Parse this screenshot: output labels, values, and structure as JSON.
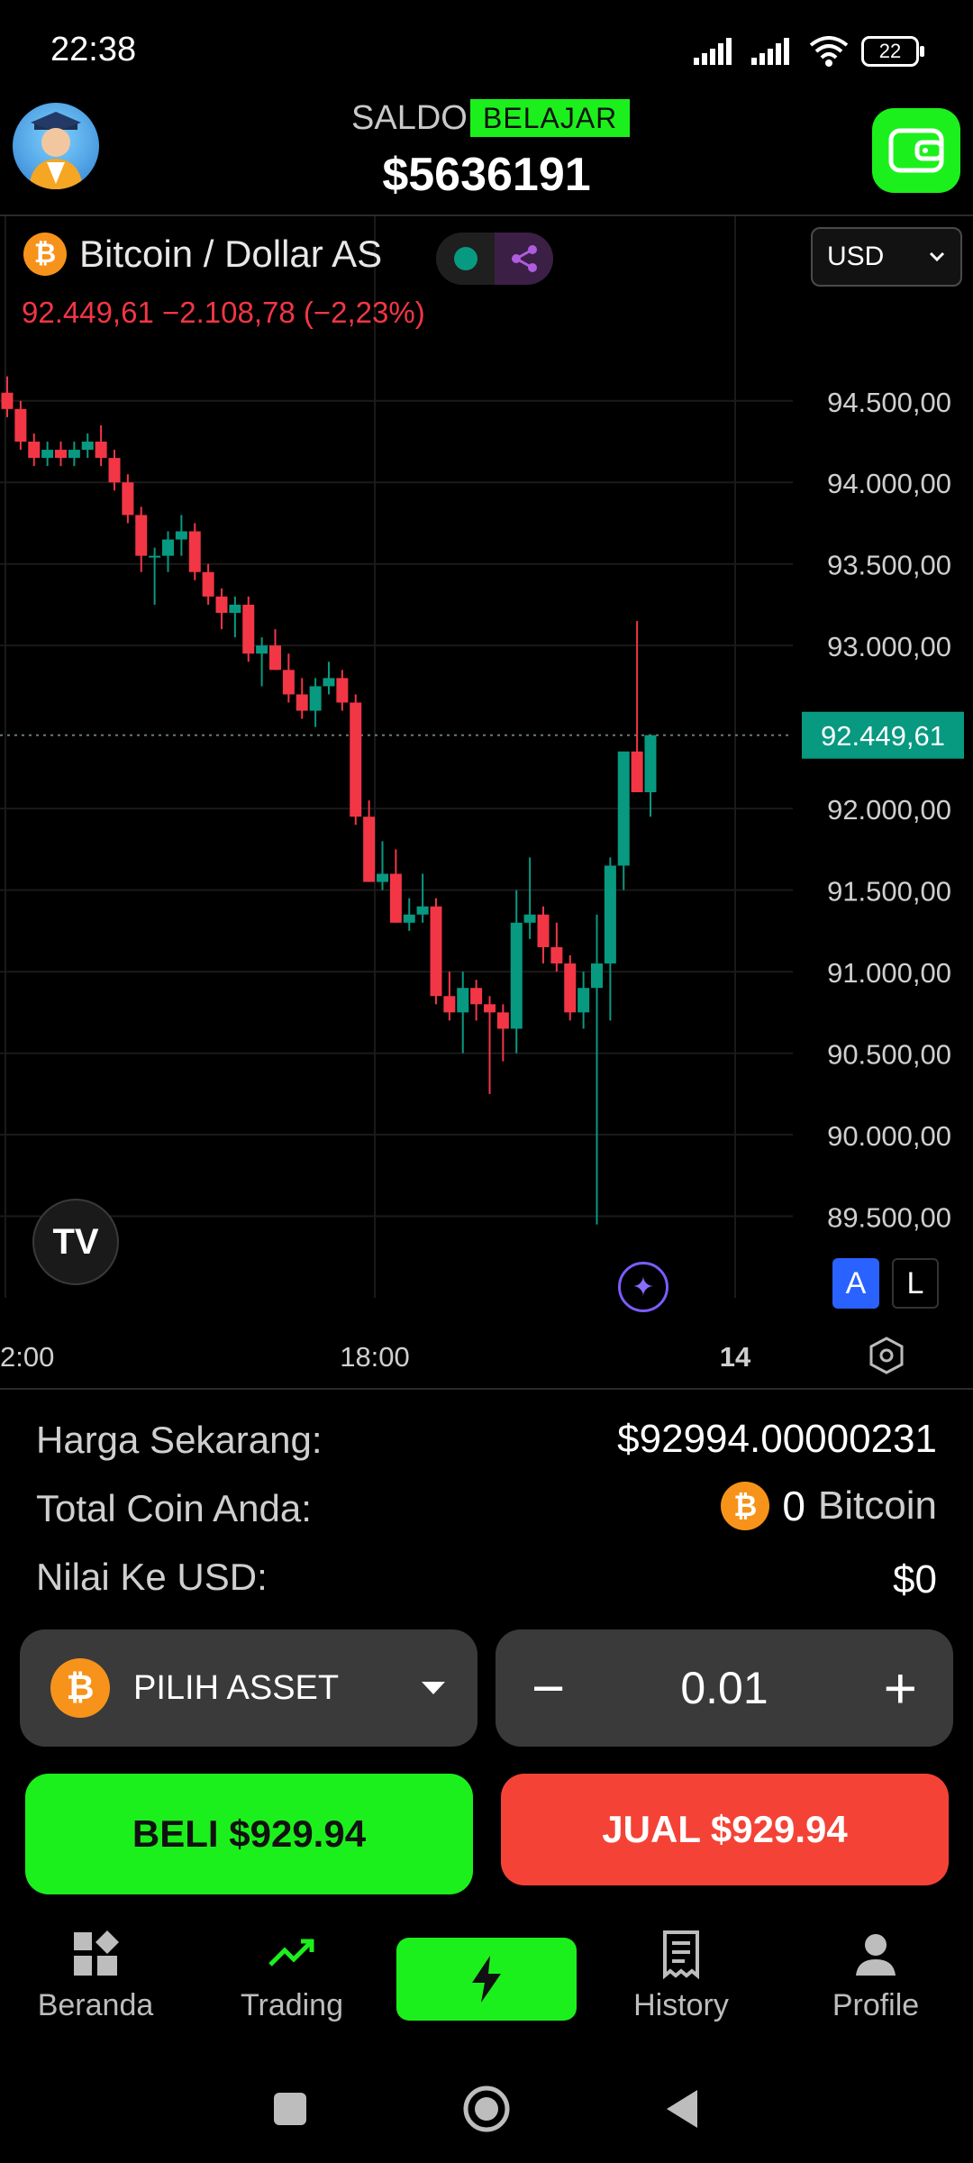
{
  "status_bar": {
    "time": "22:38",
    "battery": "22"
  },
  "header": {
    "saldo_label": "SALDO",
    "mode_badge": "BELAJAR",
    "balance": "$5636191"
  },
  "chart_header": {
    "coin_symbol": "₿",
    "title": "Bitcoin / Dollar AS",
    "price_change": "92.449,61  −2.108,78 (−2,23%)",
    "currency": "USD",
    "tv_logo": "TV",
    "auto_label": "A",
    "log_label": "L"
  },
  "chart_data": {
    "type": "candlestick",
    "y_ticks": [
      "94.500,00",
      "94.000,00",
      "93.500,00",
      "93.000,00",
      "92.000,00",
      "91.500,00",
      "91.000,00",
      "90.500,00",
      "90.000,00",
      "89.500,00"
    ],
    "y_tick_values": [
      94500,
      94000,
      93500,
      93000,
      92000,
      91500,
      91000,
      90500,
      90000,
      89500
    ],
    "ylim": [
      89000,
      95300
    ],
    "x_ticks": [
      "2:00",
      "18:00",
      "14"
    ],
    "current_price_label": "92.449,61",
    "current_price": 92449.61,
    "colors": {
      "up": "#089981",
      "down": "#f23645",
      "grid": "#1a1a1a",
      "price_tag": "#089981"
    },
    "candles": [
      [
        94550,
        94650,
        94400,
        94450
      ],
      [
        94450,
        94500,
        94200,
        94250
      ],
      [
        94250,
        94300,
        94100,
        94150
      ],
      [
        94150,
        94250,
        94100,
        94200
      ],
      [
        94200,
        94250,
        94100,
        94150
      ],
      [
        94150,
        94250,
        94100,
        94200
      ],
      [
        94200,
        94300,
        94150,
        94250
      ],
      [
        94250,
        94350,
        94100,
        94150
      ],
      [
        94150,
        94200,
        93950,
        94000
      ],
      [
        94000,
        94050,
        93750,
        93800
      ],
      [
        93800,
        93850,
        93450,
        93550
      ],
      [
        93550,
        93600,
        93250,
        93550
      ],
      [
        93550,
        93700,
        93450,
        93650
      ],
      [
        93650,
        93800,
        93550,
        93700
      ],
      [
        93700,
        93750,
        93400,
        93450
      ],
      [
        93450,
        93500,
        93250,
        93300
      ],
      [
        93300,
        93350,
        93100,
        93200
      ],
      [
        93200,
        93300,
        93050,
        93250
      ],
      [
        93250,
        93300,
        92900,
        92950
      ],
      [
        92950,
        93050,
        92750,
        93000
      ],
      [
        93000,
        93100,
        92850,
        92850
      ],
      [
        92850,
        92950,
        92650,
        92700
      ],
      [
        92700,
        92800,
        92550,
        92600
      ],
      [
        92600,
        92800,
        92500,
        92750
      ],
      [
        92750,
        92900,
        92700,
        92800
      ],
      [
        92800,
        92850,
        92600,
        92650
      ],
      [
        92650,
        92700,
        91900,
        91950
      ],
      [
        91950,
        92050,
        91550,
        91550
      ],
      [
        91550,
        91800,
        91500,
        91600
      ],
      [
        91600,
        91750,
        91300,
        91300
      ],
      [
        91300,
        91450,
        91250,
        91350
      ],
      [
        91350,
        91600,
        91300,
        91400
      ],
      [
        91400,
        91450,
        90800,
        90850
      ],
      [
        90850,
        91000,
        90700,
        90750
      ],
      [
        90750,
        91000,
        90500,
        90900
      ],
      [
        90900,
        90950,
        90700,
        90800
      ],
      [
        90800,
        90850,
        90250,
        90750
      ],
      [
        90750,
        90800,
        90450,
        90650
      ],
      [
        90650,
        91500,
        90500,
        91300
      ],
      [
        91300,
        91700,
        91200,
        91350
      ],
      [
        91350,
        91400,
        91050,
        91150
      ],
      [
        91150,
        91300,
        91000,
        91050
      ],
      [
        91050,
        91100,
        90700,
        90750
      ],
      [
        90750,
        91000,
        90650,
        90900
      ],
      [
        90900,
        91350,
        89450,
        91050
      ],
      [
        91050,
        91700,
        90700,
        91650
      ],
      [
        91650,
        92300,
        91500,
        92350
      ],
      [
        92350,
        93150,
        92150,
        92100
      ],
      [
        92100,
        92400,
        91950,
        92450
      ]
    ]
  },
  "info": {
    "price_label": "Harga Sekarang:",
    "price_value": "$92994.00000231",
    "coins_label": "Total Coin Anda:",
    "coins_value": "0",
    "coins_unit": "Bitcoin",
    "usd_label": "Nilai Ke USD:",
    "usd_value": "$0"
  },
  "asset_picker": {
    "label": "PILIH ASSET"
  },
  "quantity": {
    "value": "0.01",
    "minus": "−",
    "plus": "+"
  },
  "actions": {
    "buy": "BELI $929.94",
    "sell": "JUAL $929.94"
  },
  "nav": {
    "home": "Beranda",
    "trading": "Trading",
    "history": "History",
    "profile": "Profile"
  },
  "theme": {
    "accent_green": "#1cf01c",
    "sell_red": "#f44336"
  }
}
